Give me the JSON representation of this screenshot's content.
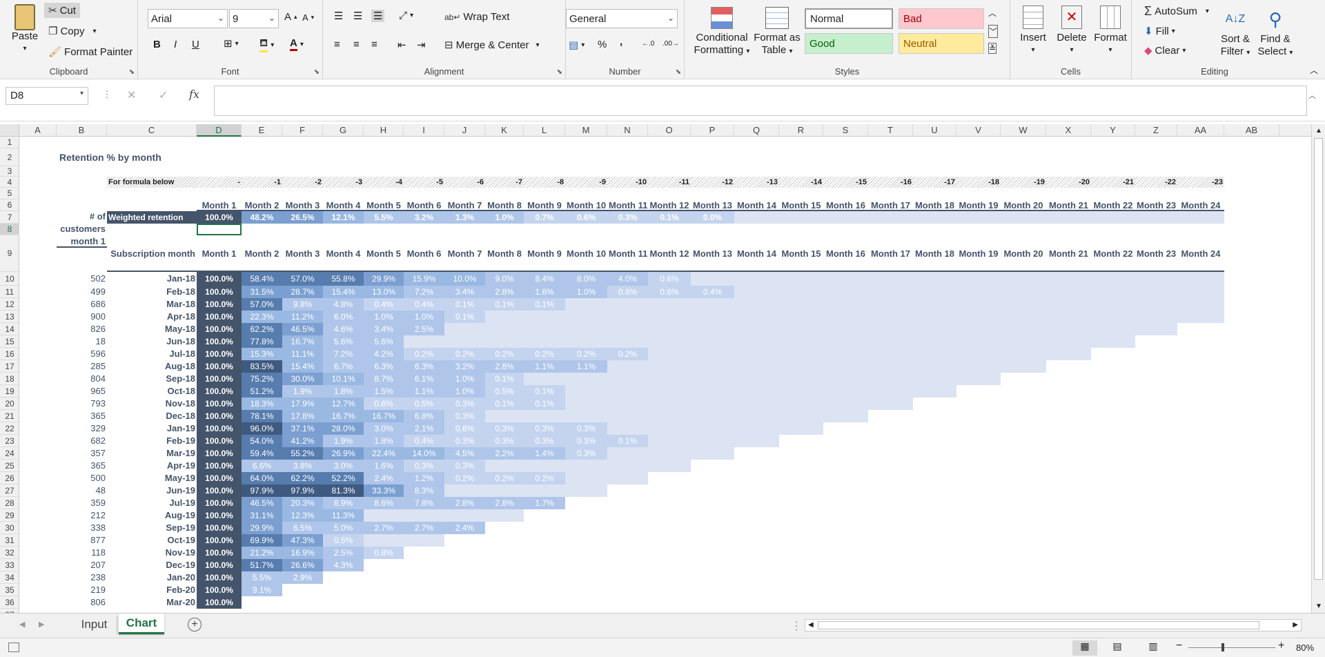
{
  "ribbon": {
    "clipboard": {
      "label": "Clipboard",
      "paste": "Paste",
      "cut": "Cut",
      "copy": "Copy",
      "format_painter": "Format Painter"
    },
    "font": {
      "label": "Font",
      "name": "Arial",
      "size": "9",
      "bold": "B",
      "italic": "I",
      "underline": "U"
    },
    "alignment": {
      "label": "Alignment",
      "wrap_text": "Wrap Text",
      "merge_center": "Merge & Center"
    },
    "number": {
      "label": "Number",
      "format": "General",
      "percent": "%",
      "comma": ","
    },
    "styles": {
      "label": "Styles",
      "conditional_formatting": [
        "Conditional",
        "Formatting"
      ],
      "format_as_table": [
        "Format as",
        "Table"
      ],
      "normal": "Normal",
      "bad": "Bad",
      "good": "Good",
      "neutral": "Neutral"
    },
    "cells": {
      "label": "Cells",
      "insert": "Insert",
      "delete": "Delete",
      "format": "Format"
    },
    "editing": {
      "label": "Editing",
      "autosum": "AutoSum",
      "fill": "Fill",
      "clear": "Clear",
      "sort_filter": [
        "Sort &",
        "Filter"
      ],
      "find_select": [
        "Find &",
        "Select"
      ]
    }
  },
  "formula_bar": {
    "name_box": "D8",
    "fx": "fx",
    "content": ""
  },
  "columns": [
    "A",
    "B",
    "C",
    "D",
    "E",
    "F",
    "G",
    "H",
    "I",
    "J",
    "K",
    "L",
    "M",
    "N",
    "O",
    "P",
    "Q",
    "R",
    "S",
    "T",
    "U",
    "V",
    "W",
    "X",
    "Y",
    "Z",
    "AA",
    "AB"
  ],
  "rows": [
    "1",
    "2",
    "3",
    "4",
    "5",
    "6",
    "7",
    "8",
    "9",
    "10",
    "11",
    "12",
    "13",
    "14",
    "15",
    "16",
    "17",
    "18",
    "19",
    "20",
    "21",
    "22",
    "23",
    "24",
    "25",
    "26",
    "27",
    "28",
    "29",
    "30",
    "31",
    "32",
    "33",
    "34",
    "35",
    "36",
    "37"
  ],
  "sheet": {
    "title": "Retention % by month",
    "formula_label": "For formula below",
    "offsets": [
      "-",
      "-1",
      "-2",
      "-3",
      "-4",
      "-5",
      "-6",
      "-7",
      "-8",
      "-9",
      "-10",
      "-11",
      "-12",
      "-13",
      "-14",
      "-15",
      "-16",
      "-17",
      "-18",
      "-19",
      "-20",
      "-21",
      "-22",
      "-23"
    ],
    "months": [
      "Month 1",
      "Month 2",
      "Month 3",
      "Month 4",
      "Month 5",
      "Month 6",
      "Month 7",
      "Month 8",
      "Month 9",
      "Month 10",
      "Month 11",
      "Month 12",
      "Month 13",
      "Month 14",
      "Month 15",
      "Month 16",
      "Month 17",
      "Month 18",
      "Month 19",
      "Month 20",
      "Month 21",
      "Month 22",
      "Month 23",
      "Month 24"
    ],
    "weighted_label": "Weighted retention",
    "weighted": [
      "100.0%",
      "48.2%",
      "26.5%",
      "12.1%",
      "5.5%",
      "3.2%",
      "1.3%",
      "1.0%",
      "0.7%",
      "0.6%",
      "0.3%",
      "0.1%",
      "0.0%",
      "-",
      "-",
      "-",
      "-",
      "-",
      "-",
      "-",
      "-",
      "-",
      "-",
      "-"
    ],
    "customers_header": [
      "# of",
      "customers",
      "month 1"
    ],
    "subscription_header": "Subscription month",
    "cohorts": [
      {
        "customers": "502",
        "month": "Jan-18",
        "values": [
          "100.0%",
          "58.4%",
          "57.0%",
          "55.8%",
          "29.9%",
          "15.9%",
          "10.0%",
          "9.0%",
          "8.4%",
          "8.0%",
          "4.0%",
          "0.6%",
          "-",
          "-",
          "-",
          "-",
          "-",
          "-",
          "-",
          "-",
          "-",
          "-",
          "-",
          "-"
        ]
      },
      {
        "customers": "499",
        "month": "Feb-18",
        "values": [
          "100.0%",
          "31.5%",
          "28.7%",
          "15.4%",
          "13.0%",
          "7.2%",
          "3.4%",
          "2.8%",
          "1.6%",
          "1.0%",
          "0.8%",
          "0.6%",
          "0.4%",
          "-",
          "-",
          "-",
          "-",
          "-",
          "-",
          "-",
          "-",
          "-",
          "-",
          "-"
        ]
      },
      {
        "customers": "686",
        "month": "Mar-18",
        "values": [
          "100.0%",
          "57.0%",
          "9.8%",
          "4.8%",
          "0.4%",
          "0.4%",
          "0.1%",
          "0.1%",
          "0.1%",
          "-",
          "-",
          "-",
          "-",
          "-",
          "-",
          "-",
          "-",
          "-",
          "-",
          "-",
          "-",
          "-",
          "-",
          "-"
        ]
      },
      {
        "customers": "900",
        "month": "Apr-18",
        "values": [
          "100.0%",
          "22.3%",
          "11.2%",
          "6.0%",
          "1.0%",
          "1.0%",
          "0.1%",
          "-",
          "-",
          "-",
          "-",
          "-",
          "-",
          "-",
          "-",
          "-",
          "-",
          "-",
          "-",
          "-",
          "-",
          "-",
          "-",
          "-"
        ]
      },
      {
        "customers": "826",
        "month": "May-18",
        "values": [
          "100.0%",
          "62.2%",
          "46.5%",
          "4.6%",
          "3.4%",
          "2.5%",
          "-",
          "-",
          "-",
          "-",
          "-",
          "-",
          "-",
          "-",
          "-",
          "-",
          "-",
          "-",
          "-",
          "-",
          "-",
          "-",
          "-"
        ]
      },
      {
        "customers": "18",
        "month": "Jun-18",
        "values": [
          "100.0%",
          "77.8%",
          "16.7%",
          "5.6%",
          "5.6%",
          "-",
          "-",
          "-",
          "-",
          "-",
          "-",
          "-",
          "-",
          "-",
          "-",
          "-",
          "-",
          "-",
          "-",
          "-",
          "-",
          "-"
        ]
      },
      {
        "customers": "596",
        "month": "Jul-18",
        "values": [
          "100.0%",
          "15.3%",
          "11.1%",
          "7.2%",
          "4.2%",
          "0.2%",
          "0.2%",
          "0.2%",
          "0.2%",
          "0.2%",
          "0.2%",
          "-",
          "-",
          "-",
          "-",
          "-",
          "-",
          "-",
          "-",
          "-",
          "-"
        ]
      },
      {
        "customers": "285",
        "month": "Aug-18",
        "values": [
          "100.0%",
          "83.5%",
          "15.4%",
          "6.7%",
          "6.3%",
          "6.3%",
          "3.2%",
          "2.8%",
          "1.1%",
          "1.1%",
          "-",
          "-",
          "-",
          "-",
          "-",
          "-",
          "-",
          "-",
          "-",
          "-"
        ]
      },
      {
        "customers": "804",
        "month": "Sep-18",
        "values": [
          "100.0%",
          "75.2%",
          "30.0%",
          "10.1%",
          "8.7%",
          "6.1%",
          "1.0%",
          "0.1%",
          "-",
          "-",
          "-",
          "-",
          "-",
          "-",
          "-",
          "-",
          "-",
          "-",
          "-"
        ]
      },
      {
        "customers": "965",
        "month": "Oct-18",
        "values": [
          "100.0%",
          "51.2%",
          "1.9%",
          "1.8%",
          "1.5%",
          "1.1%",
          "1.0%",
          "0.5%",
          "0.1%",
          "-",
          "-",
          "-",
          "-",
          "-",
          "-",
          "-",
          "-",
          "-"
        ]
      },
      {
        "customers": "793",
        "month": "Nov-18",
        "values": [
          "100.0%",
          "18.3%",
          "17.9%",
          "12.7%",
          "0.6%",
          "0.5%",
          "0.3%",
          "0.1%",
          "0.1%",
          "-",
          "-",
          "-",
          "-",
          "-",
          "-",
          "-",
          "-"
        ]
      },
      {
        "customers": "365",
        "month": "Dec-18",
        "values": [
          "100.0%",
          "78.1%",
          "17.8%",
          "16.7%",
          "16.7%",
          "6.8%",
          "0.3%",
          "-",
          "-",
          "-",
          "-",
          "-",
          "-",
          "-",
          "-",
          "-"
        ]
      },
      {
        "customers": "329",
        "month": "Jan-19",
        "values": [
          "100.0%",
          "96.0%",
          "37.1%",
          "28.0%",
          "3.0%",
          "2.1%",
          "0.6%",
          "0.3%",
          "0.3%",
          "0.3%",
          "-",
          "-",
          "-",
          "-",
          "-"
        ]
      },
      {
        "customers": "682",
        "month": "Feb-19",
        "values": [
          "100.0%",
          "54.0%",
          "41.2%",
          "1.9%",
          "1.8%",
          "0.4%",
          "0.3%",
          "0.3%",
          "0.3%",
          "0.3%",
          "0.1%",
          "-",
          "-",
          "-"
        ]
      },
      {
        "customers": "357",
        "month": "Mar-19",
        "values": [
          "100.0%",
          "59.4%",
          "55.2%",
          "26.9%",
          "22.4%",
          "14.0%",
          "4.5%",
          "2.2%",
          "1.4%",
          "0.3%",
          "-",
          "-",
          "-"
        ]
      },
      {
        "customers": "365",
        "month": "Apr-19",
        "values": [
          "100.0%",
          "6.6%",
          "3.8%",
          "3.0%",
          "1.6%",
          "0.3%",
          "0.3%",
          "-",
          "-",
          "-",
          "-",
          "-"
        ]
      },
      {
        "customers": "500",
        "month": "May-19",
        "values": [
          "100.0%",
          "64.0%",
          "62.2%",
          "52.2%",
          "2.4%",
          "1.2%",
          "0.2%",
          "0.2%",
          "0.2%",
          "-",
          "-"
        ]
      },
      {
        "customers": "48",
        "month": "Jun-19",
        "values": [
          "100.0%",
          "97.9%",
          "97.9%",
          "81.3%",
          "33.3%",
          "8.3%",
          "-",
          "-",
          "-",
          "-"
        ]
      },
      {
        "customers": "359",
        "month": "Jul-19",
        "values": [
          "100.0%",
          "46.5%",
          "20.3%",
          "8.9%",
          "8.6%",
          "7.8%",
          "2.8%",
          "2.8%",
          "1.7%"
        ]
      },
      {
        "customers": "212",
        "month": "Aug-19",
        "values": [
          "100.0%",
          "31.1%",
          "12.3%",
          "11.3%",
          "-",
          "-",
          "-",
          "-"
        ]
      },
      {
        "customers": "338",
        "month": "Sep-19",
        "values": [
          "100.0%",
          "29.9%",
          "6.5%",
          "5.0%",
          "2.7%",
          "2.7%",
          "2.4%"
        ]
      },
      {
        "customers": "877",
        "month": "Oct-19",
        "values": [
          "100.0%",
          "69.9%",
          "47.3%",
          "0.5%",
          "-",
          "-"
        ]
      },
      {
        "customers": "118",
        "month": "Nov-19",
        "values": [
          "100.0%",
          "21.2%",
          "16.9%",
          "2.5%",
          "0.8%"
        ]
      },
      {
        "customers": "207",
        "month": "Dec-19",
        "values": [
          "100.0%",
          "51.7%",
          "26.6%",
          "4.3%"
        ]
      },
      {
        "customers": "238",
        "month": "Jan-20",
        "values": [
          "100.0%",
          "5.5%",
          "2.9%"
        ]
      },
      {
        "customers": "219",
        "month": "Feb-20",
        "values": [
          "100.0%",
          "9.1%"
        ]
      },
      {
        "customers": "806",
        "month": "Mar-20",
        "values": [
          "100.0%"
        ]
      }
    ]
  },
  "tabs": {
    "input": "Input",
    "chart": "Chart",
    "add": "+"
  },
  "status": {
    "zoom": "80%"
  },
  "colors": {
    "header_dark": "#44546a",
    "light_fill": "#dce3f2",
    "accent_green": "#217346"
  }
}
